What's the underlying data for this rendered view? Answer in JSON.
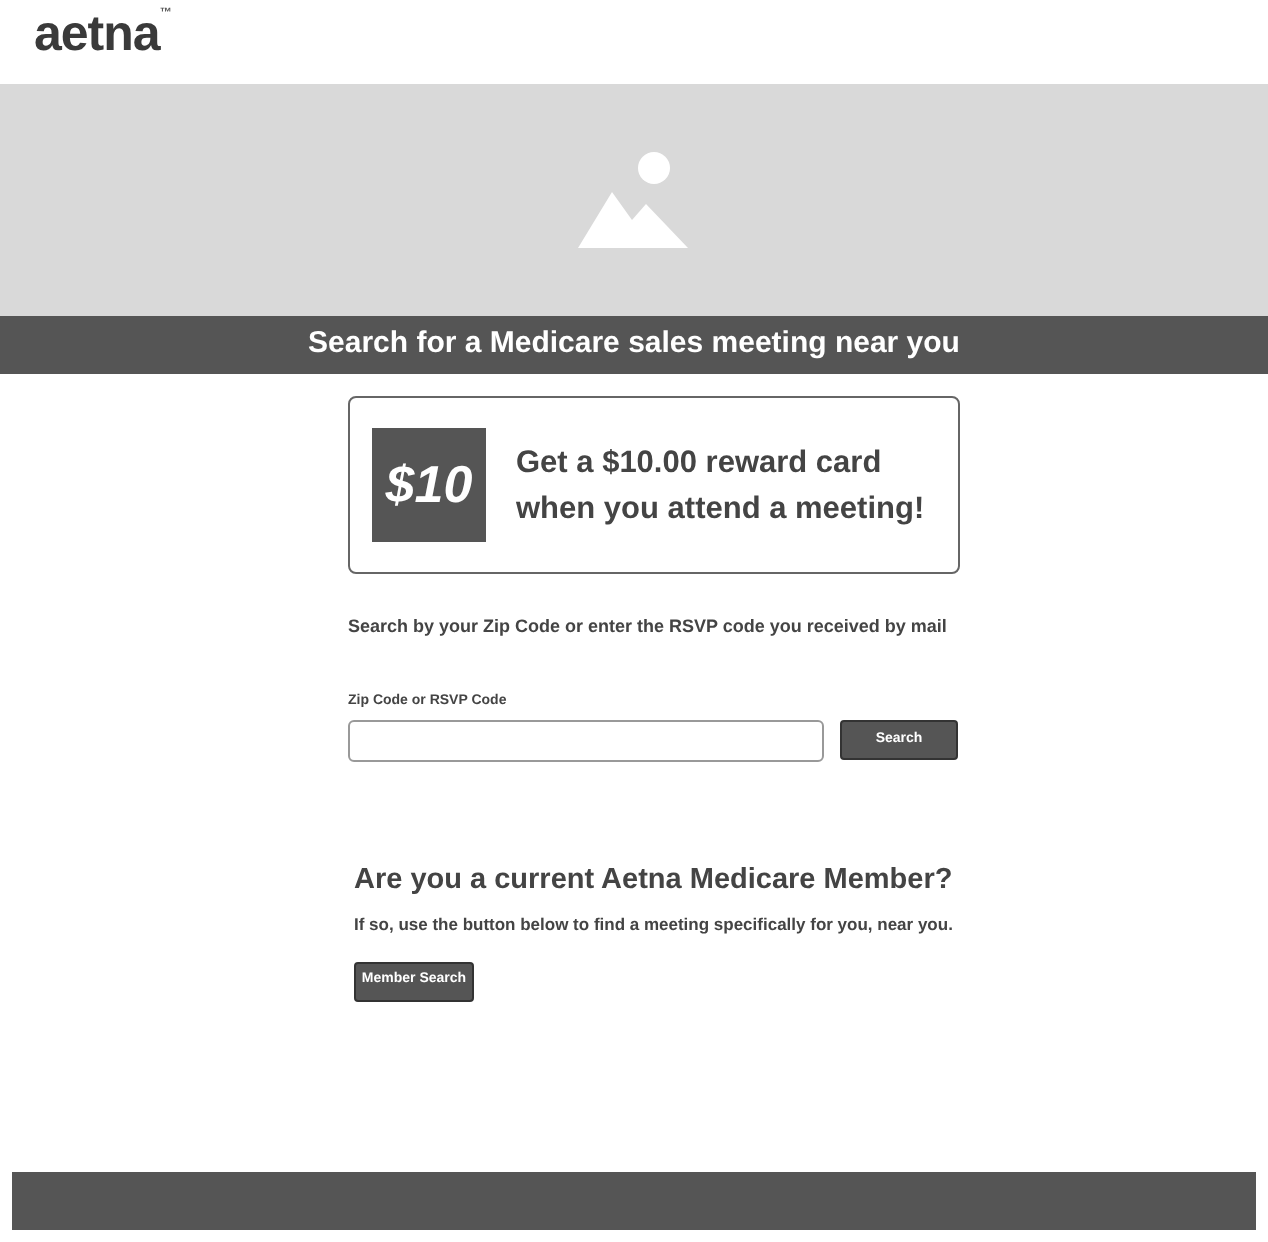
{
  "logo": {
    "text": "aetna",
    "mark": "™"
  },
  "banner": {
    "title": "Search for a Medicare sales meeting near you"
  },
  "promo": {
    "badge": "$10",
    "lines": [
      "Get a $10.00 reward card",
      "when you attend a meeting!"
    ]
  },
  "search": {
    "intro": "Search by your Zip Code or enter the RSVP code you received by mail",
    "label": "Zip Code or RSVP Code",
    "button": "Search"
  },
  "member": {
    "heading": "Are you a current Aetna Medicare Member?",
    "text": "If so, use the button below to find a meeting specifically for you, near you.",
    "button": "Member Search"
  }
}
